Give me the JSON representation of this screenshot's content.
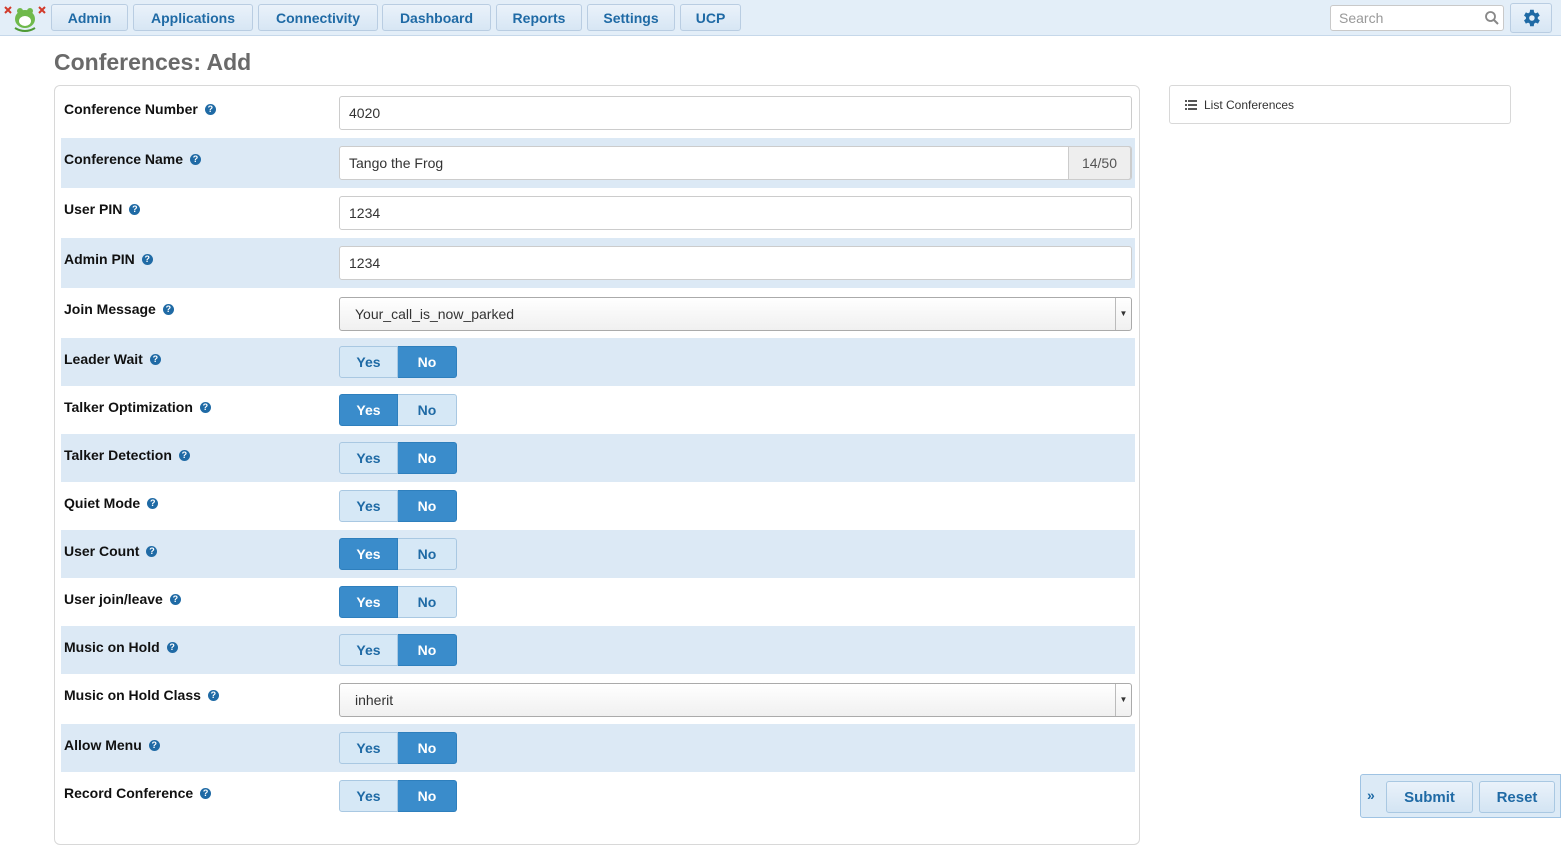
{
  "nav": {
    "items": [
      {
        "label": "Admin"
      },
      {
        "label": "Applications"
      },
      {
        "label": "Connectivity"
      },
      {
        "label": "Dashboard"
      },
      {
        "label": "Reports"
      },
      {
        "label": "Settings"
      },
      {
        "label": "UCP"
      }
    ],
    "search_placeholder": "Search",
    "logo_icon": "frog-logo-icon",
    "settings_icon": "gear-icon"
  },
  "page_title": "Conferences: Add",
  "form": {
    "conference_number": {
      "label": "Conference Number",
      "value": "4020"
    },
    "conference_name": {
      "label": "Conference Name",
      "value": "Tango the Frog",
      "counter": "14/50"
    },
    "user_pin": {
      "label": "User PIN",
      "value": "1234"
    },
    "admin_pin": {
      "label": "Admin PIN",
      "value": "1234"
    },
    "join_message": {
      "label": "Join Message",
      "value": "Your_call_is_now_parked"
    },
    "leader_wait": {
      "label": "Leader Wait",
      "selected": "No"
    },
    "talker_optimization": {
      "label": "Talker Optimization",
      "selected": "Yes"
    },
    "talker_detection": {
      "label": "Talker Detection",
      "selected": "No"
    },
    "quiet_mode": {
      "label": "Quiet Mode",
      "selected": "No"
    },
    "user_count": {
      "label": "User Count",
      "selected": "Yes"
    },
    "user_join_leave": {
      "label": "User join/leave",
      "selected": "Yes"
    },
    "music_on_hold": {
      "label": "Music on Hold",
      "selected": "No"
    },
    "music_on_hold_class": {
      "label": "Music on Hold Class",
      "value": "inherit"
    },
    "allow_menu": {
      "label": "Allow Menu",
      "selected": "No"
    },
    "record_conference": {
      "label": "Record Conference",
      "selected": "No"
    },
    "yes_label": "Yes",
    "no_label": "No",
    "help_glyph": "?"
  },
  "side": {
    "list_link": "List Conferences"
  },
  "actions": {
    "submit": "Submit",
    "reset": "Reset",
    "expand_glyph": "»"
  },
  "colors": {
    "accent": "#3a8ccb",
    "nav_bg": "#e3eef8",
    "row_shade": "#dce9f5"
  }
}
